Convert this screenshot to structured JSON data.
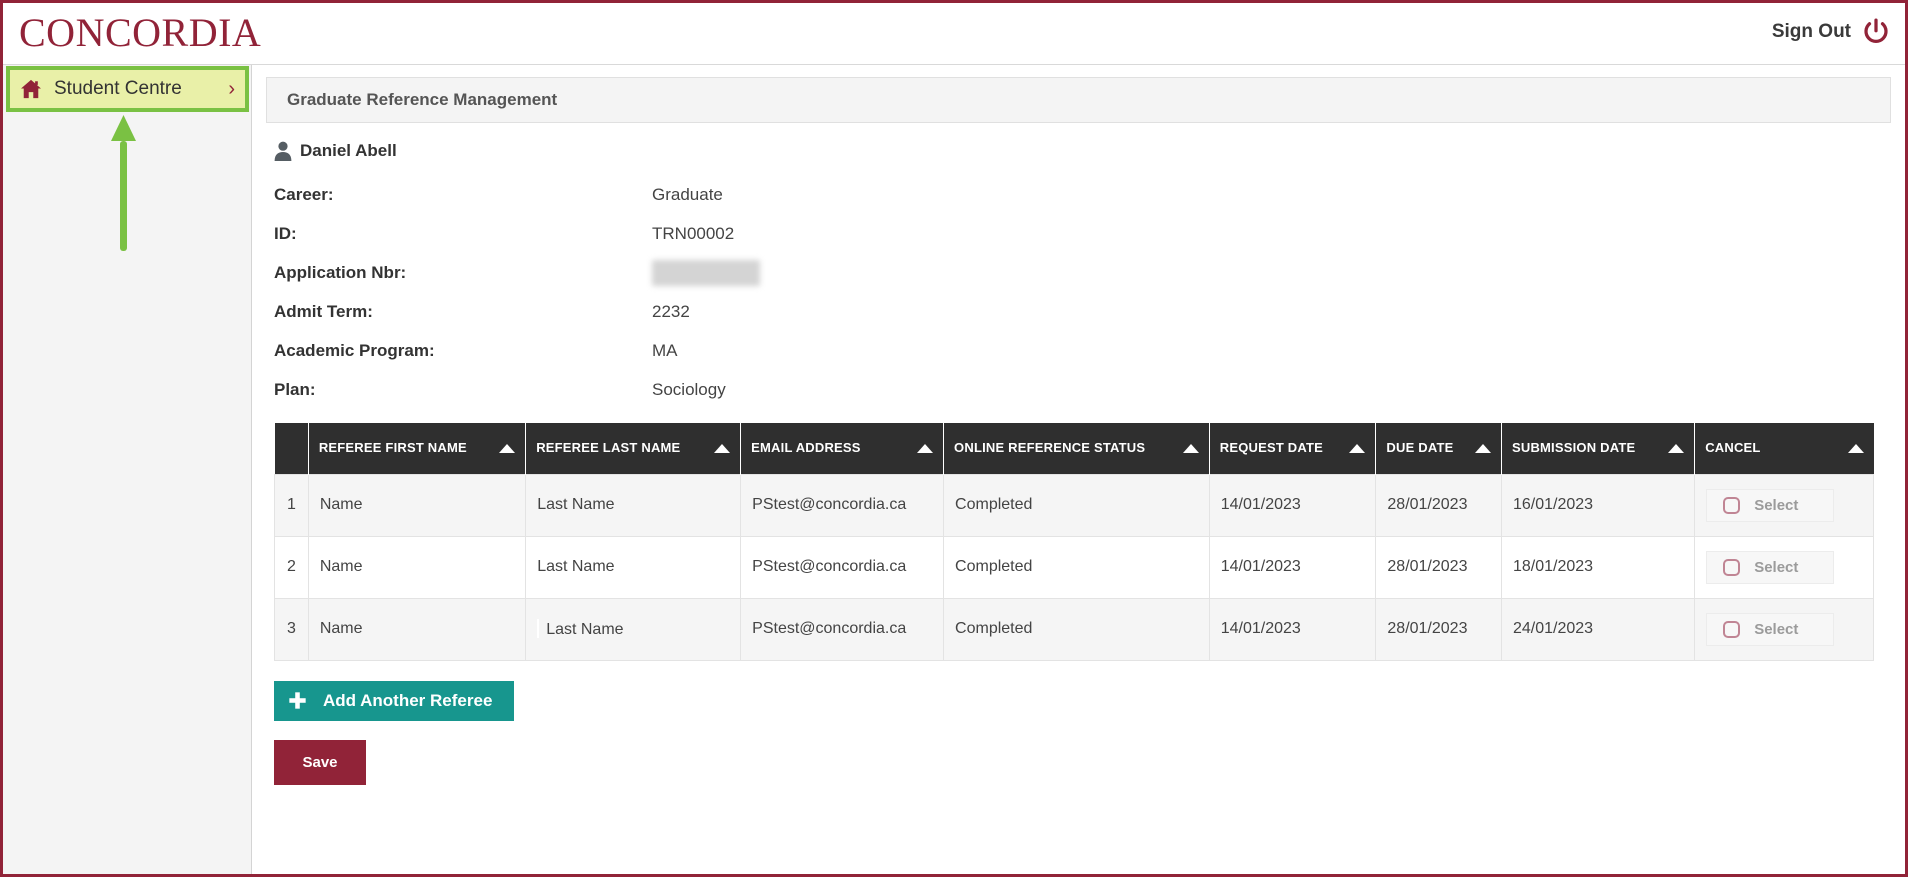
{
  "colors": {
    "brand_maroon": "#912338",
    "highlight_green": "#7ac143",
    "highlight_fill": "#e9f0a8",
    "teal": "#17968e",
    "header_dark": "#2f2f2f"
  },
  "topbar": {
    "brand": "CONCORDIA",
    "signout_label": "Sign Out",
    "signout_icon": "power-icon"
  },
  "sidebar": {
    "items": [
      {
        "label": "Student Centre",
        "icon": "home-icon",
        "chevron": "›",
        "highlighted": true
      }
    ]
  },
  "main": {
    "panel_title": "Graduate Reference Management",
    "person": {
      "icon": "person-icon",
      "name": "Daniel Abell"
    },
    "fields": [
      {
        "label": "Career:",
        "value": "Graduate"
      },
      {
        "label": "ID:",
        "value": "TRN00002"
      },
      {
        "label": "Application Nbr:",
        "value": "",
        "redacted": true
      },
      {
        "label": "Admit Term:",
        "value": "2232"
      },
      {
        "label": "Academic Program:",
        "value": "MA"
      },
      {
        "label": "Plan:",
        "value": "Sociology"
      }
    ],
    "table": {
      "columns": [
        {
          "label": "",
          "key": "num",
          "sortable": false
        },
        {
          "label": "REFEREE FIRST NAME",
          "key": "first_name",
          "sortable": true
        },
        {
          "label": "REFEREE LAST NAME",
          "key": "last_name",
          "sortable": true
        },
        {
          "label": "EMAIL ADDRESS",
          "key": "email",
          "sortable": true
        },
        {
          "label": "ONLINE REFERENCE STATUS",
          "key": "status",
          "sortable": true
        },
        {
          "label": "REQUEST DATE",
          "key": "request_date",
          "sortable": true
        },
        {
          "label": "DUE DATE",
          "key": "due_date",
          "sortable": true
        },
        {
          "label": "SUBMISSION DATE",
          "key": "submission_date",
          "sortable": true
        },
        {
          "label": "CANCEL",
          "key": "cancel",
          "sortable": true
        }
      ],
      "rows": [
        {
          "num": "1",
          "first_name": "Name",
          "last_name": "Last Name",
          "email": "PStest@concordia.ca",
          "status": "Completed",
          "request_date": "14/01/2023",
          "due_date": "28/01/2023",
          "submission_date": "16/01/2023",
          "cancel_label": "Select",
          "caret": false
        },
        {
          "num": "2",
          "first_name": "Name",
          "last_name": "Last Name",
          "email": "PStest@concordia.ca",
          "status": "Completed",
          "request_date": "14/01/2023",
          "due_date": "28/01/2023",
          "submission_date": "18/01/2023",
          "cancel_label": "Select",
          "caret": false
        },
        {
          "num": "3",
          "first_name": "Name",
          "last_name": "Last Name",
          "email": "PStest@concordia.ca",
          "status": "Completed",
          "request_date": "14/01/2023",
          "due_date": "28/01/2023",
          "submission_date": "24/01/2023",
          "cancel_label": "Select",
          "caret": true
        }
      ]
    },
    "buttons": {
      "add_referee": "Add Another Referee",
      "add_referee_icon": "plus-icon",
      "save": "Save"
    }
  },
  "annotation": {
    "arrow": "up-arrow",
    "points_to": "Student Centre"
  }
}
